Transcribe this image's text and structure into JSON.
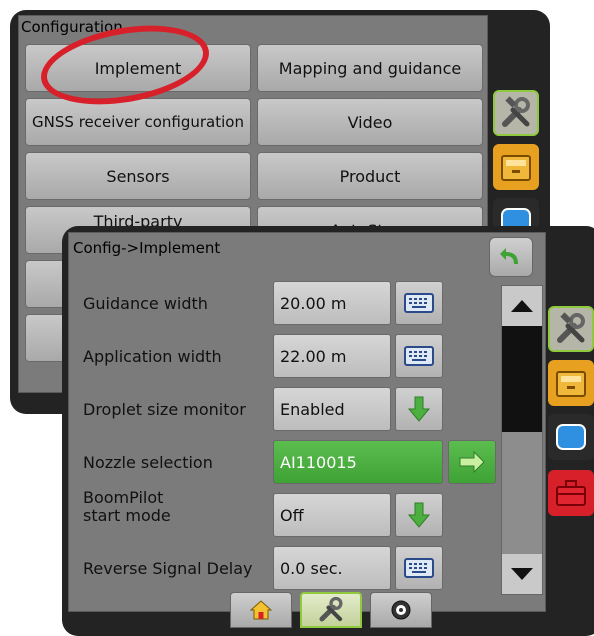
{
  "back_panel": {
    "title": "Configuration",
    "buttons": [
      {
        "label": "Implement"
      },
      {
        "label": "Mapping and guidance"
      },
      {
        "label": "GNSS receiver configuration"
      },
      {
        "label": "Video"
      },
      {
        "label": "Sensors"
      },
      {
        "label": "Product"
      },
      {
        "label": "Third-party"
      },
      {
        "label": "AutoSteer"
      }
    ],
    "side_icons": [
      "tools-icon",
      "console-icon",
      "screen-icon"
    ]
  },
  "front_panel": {
    "title": "Config->Implement",
    "rows": [
      {
        "label": "Guidance width",
        "value": "20.00 m",
        "action": "keyboard-icon"
      },
      {
        "label": "Application width",
        "value": "22.00 m",
        "action": "keyboard-icon"
      },
      {
        "label": "Droplet size monitor",
        "value": "Enabled",
        "action": "down-arrow-icon"
      },
      {
        "label": "Nozzle selection",
        "value": "AI110015",
        "action": "right-arrow-icon"
      },
      {
        "label": "BoomPilot\nstart mode",
        "value": "Off",
        "action": "down-arrow-icon"
      },
      {
        "label": "Reverse Signal Delay",
        "value": "0.0 sec.",
        "action": "keyboard-icon"
      }
    ],
    "side_icons": [
      "tools-icon",
      "console-icon",
      "screen-icon",
      "toolbox-icon"
    ],
    "bottom_tabs": [
      "home-icon",
      "tools-icon",
      "gauge-icon"
    ]
  },
  "colors": {
    "accent_green": "#8fc93e",
    "annotation_red": "#d8202a",
    "value_green": "#4caf40"
  }
}
